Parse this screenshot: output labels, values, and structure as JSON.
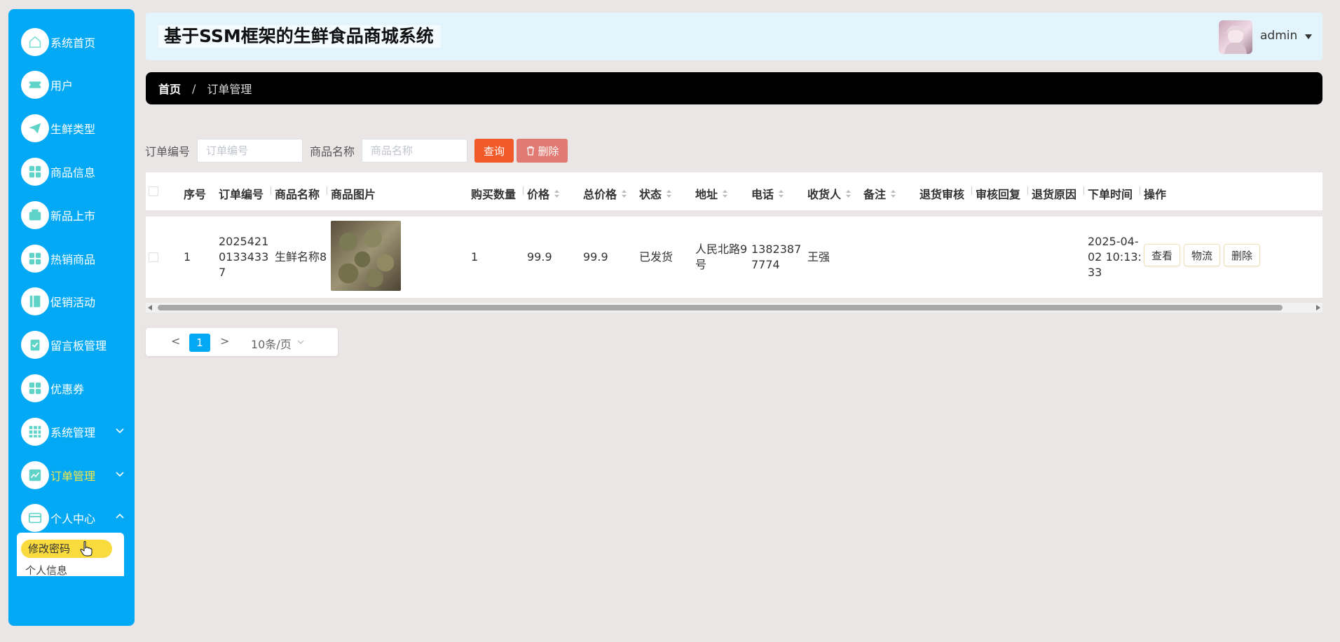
{
  "app": {
    "title": "基于SSM框架的生鲜食品商城系统",
    "username": "admin"
  },
  "sidebar": {
    "items": [
      {
        "label": "系统首页",
        "icon": "home-icon"
      },
      {
        "label": "用户",
        "icon": "ticket-icon"
      },
      {
        "label": "生鲜类型",
        "icon": "paper-plane-icon"
      },
      {
        "label": "商品信息",
        "icon": "grid-icon"
      },
      {
        "label": "新品上市",
        "icon": "wallet-icon"
      },
      {
        "label": "热销商品",
        "icon": "grid-icon"
      },
      {
        "label": "促销活动",
        "icon": "book-icon"
      },
      {
        "label": "留言板管理",
        "icon": "clipboard-icon"
      },
      {
        "label": "优惠券",
        "icon": "grid-icon"
      },
      {
        "label": "系统管理",
        "icon": "apps-icon"
      },
      {
        "label": "订单管理",
        "icon": "chart-icon"
      },
      {
        "label": "个人中心",
        "icon": "card-icon"
      }
    ],
    "submenu": {
      "active": "修改密码",
      "second": "个人信息"
    }
  },
  "breadcrumb": {
    "home": "首页",
    "separator": "/",
    "current": "订单管理"
  },
  "search": {
    "order_no_label": "订单编号",
    "order_no_placeholder": "订单编号",
    "product_label": "商品名称",
    "product_placeholder": "商品名称",
    "query_button": "查询",
    "delete_button": "删除"
  },
  "table": {
    "headers": [
      "序号",
      "订单编号",
      "商品名称",
      "商品图片",
      "购买数量",
      "价格",
      "总价格",
      "状态",
      "地址",
      "电话",
      "收货人",
      "备注",
      "退货审核",
      "审核回复",
      "退货原因",
      "下单时间",
      "操作"
    ],
    "rows": [
      {
        "index": "1",
        "order_no_lines": [
          "20254210",
          "1334337"
        ],
        "order_no_line1": "2025421",
        "order_no_line2": "0133433",
        "order_no_line3": "7",
        "product_name": "生鲜名称8",
        "quantity": "1",
        "price": "99.9",
        "total": "99.9",
        "status": "已发货",
        "address_line1": "人民北路9",
        "address_line2": "号",
        "phone_line1": "1382387",
        "phone_line2": "7774",
        "receiver": "王强",
        "time_line1": "2025-04-",
        "time_line2": "02 10:13:",
        "time_line3": "33",
        "actions": [
          "查看",
          "物流",
          "删除"
        ]
      }
    ]
  },
  "pagination": {
    "prev": "<",
    "page": "1",
    "next": ">",
    "page_size": "10条/页"
  },
  "colors": {
    "sidebar": "#03a9f4",
    "active_label": "#f7e84a",
    "query_btn": "#f25a2a",
    "delete_btn": "#e07a72",
    "breadcrumb_bg": "#000000"
  }
}
